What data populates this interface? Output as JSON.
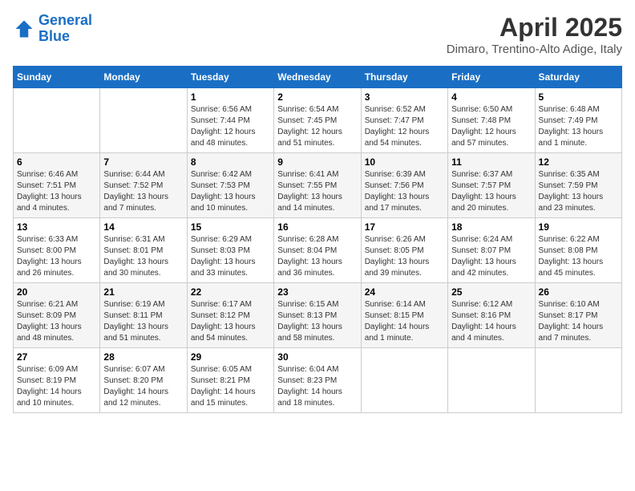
{
  "header": {
    "logo_line1": "General",
    "logo_line2": "Blue",
    "month": "April 2025",
    "location": "Dimaro, Trentino-Alto Adige, Italy"
  },
  "days_of_week": [
    "Sunday",
    "Monday",
    "Tuesday",
    "Wednesday",
    "Thursday",
    "Friday",
    "Saturday"
  ],
  "weeks": [
    [
      {
        "day": "",
        "sunrise": "",
        "sunset": "",
        "daylight": ""
      },
      {
        "day": "",
        "sunrise": "",
        "sunset": "",
        "daylight": ""
      },
      {
        "day": "1",
        "sunrise": "Sunrise: 6:56 AM",
        "sunset": "Sunset: 7:44 PM",
        "daylight": "Daylight: 12 hours and 48 minutes."
      },
      {
        "day": "2",
        "sunrise": "Sunrise: 6:54 AM",
        "sunset": "Sunset: 7:45 PM",
        "daylight": "Daylight: 12 hours and 51 minutes."
      },
      {
        "day": "3",
        "sunrise": "Sunrise: 6:52 AM",
        "sunset": "Sunset: 7:47 PM",
        "daylight": "Daylight: 12 hours and 54 minutes."
      },
      {
        "day": "4",
        "sunrise": "Sunrise: 6:50 AM",
        "sunset": "Sunset: 7:48 PM",
        "daylight": "Daylight: 12 hours and 57 minutes."
      },
      {
        "day": "5",
        "sunrise": "Sunrise: 6:48 AM",
        "sunset": "Sunset: 7:49 PM",
        "daylight": "Daylight: 13 hours and 1 minute."
      }
    ],
    [
      {
        "day": "6",
        "sunrise": "Sunrise: 6:46 AM",
        "sunset": "Sunset: 7:51 PM",
        "daylight": "Daylight: 13 hours and 4 minutes."
      },
      {
        "day": "7",
        "sunrise": "Sunrise: 6:44 AM",
        "sunset": "Sunset: 7:52 PM",
        "daylight": "Daylight: 13 hours and 7 minutes."
      },
      {
        "day": "8",
        "sunrise": "Sunrise: 6:42 AM",
        "sunset": "Sunset: 7:53 PM",
        "daylight": "Daylight: 13 hours and 10 minutes."
      },
      {
        "day": "9",
        "sunrise": "Sunrise: 6:41 AM",
        "sunset": "Sunset: 7:55 PM",
        "daylight": "Daylight: 13 hours and 14 minutes."
      },
      {
        "day": "10",
        "sunrise": "Sunrise: 6:39 AM",
        "sunset": "Sunset: 7:56 PM",
        "daylight": "Daylight: 13 hours and 17 minutes."
      },
      {
        "day": "11",
        "sunrise": "Sunrise: 6:37 AM",
        "sunset": "Sunset: 7:57 PM",
        "daylight": "Daylight: 13 hours and 20 minutes."
      },
      {
        "day": "12",
        "sunrise": "Sunrise: 6:35 AM",
        "sunset": "Sunset: 7:59 PM",
        "daylight": "Daylight: 13 hours and 23 minutes."
      }
    ],
    [
      {
        "day": "13",
        "sunrise": "Sunrise: 6:33 AM",
        "sunset": "Sunset: 8:00 PM",
        "daylight": "Daylight: 13 hours and 26 minutes."
      },
      {
        "day": "14",
        "sunrise": "Sunrise: 6:31 AM",
        "sunset": "Sunset: 8:01 PM",
        "daylight": "Daylight: 13 hours and 30 minutes."
      },
      {
        "day": "15",
        "sunrise": "Sunrise: 6:29 AM",
        "sunset": "Sunset: 8:03 PM",
        "daylight": "Daylight: 13 hours and 33 minutes."
      },
      {
        "day": "16",
        "sunrise": "Sunrise: 6:28 AM",
        "sunset": "Sunset: 8:04 PM",
        "daylight": "Daylight: 13 hours and 36 minutes."
      },
      {
        "day": "17",
        "sunrise": "Sunrise: 6:26 AM",
        "sunset": "Sunset: 8:05 PM",
        "daylight": "Daylight: 13 hours and 39 minutes."
      },
      {
        "day": "18",
        "sunrise": "Sunrise: 6:24 AM",
        "sunset": "Sunset: 8:07 PM",
        "daylight": "Daylight: 13 hours and 42 minutes."
      },
      {
        "day": "19",
        "sunrise": "Sunrise: 6:22 AM",
        "sunset": "Sunset: 8:08 PM",
        "daylight": "Daylight: 13 hours and 45 minutes."
      }
    ],
    [
      {
        "day": "20",
        "sunrise": "Sunrise: 6:21 AM",
        "sunset": "Sunset: 8:09 PM",
        "daylight": "Daylight: 13 hours and 48 minutes."
      },
      {
        "day": "21",
        "sunrise": "Sunrise: 6:19 AM",
        "sunset": "Sunset: 8:11 PM",
        "daylight": "Daylight: 13 hours and 51 minutes."
      },
      {
        "day": "22",
        "sunrise": "Sunrise: 6:17 AM",
        "sunset": "Sunset: 8:12 PM",
        "daylight": "Daylight: 13 hours and 54 minutes."
      },
      {
        "day": "23",
        "sunrise": "Sunrise: 6:15 AM",
        "sunset": "Sunset: 8:13 PM",
        "daylight": "Daylight: 13 hours and 58 minutes."
      },
      {
        "day": "24",
        "sunrise": "Sunrise: 6:14 AM",
        "sunset": "Sunset: 8:15 PM",
        "daylight": "Daylight: 14 hours and 1 minute."
      },
      {
        "day": "25",
        "sunrise": "Sunrise: 6:12 AM",
        "sunset": "Sunset: 8:16 PM",
        "daylight": "Daylight: 14 hours and 4 minutes."
      },
      {
        "day": "26",
        "sunrise": "Sunrise: 6:10 AM",
        "sunset": "Sunset: 8:17 PM",
        "daylight": "Daylight: 14 hours and 7 minutes."
      }
    ],
    [
      {
        "day": "27",
        "sunrise": "Sunrise: 6:09 AM",
        "sunset": "Sunset: 8:19 PM",
        "daylight": "Daylight: 14 hours and 10 minutes."
      },
      {
        "day": "28",
        "sunrise": "Sunrise: 6:07 AM",
        "sunset": "Sunset: 8:20 PM",
        "daylight": "Daylight: 14 hours and 12 minutes."
      },
      {
        "day": "29",
        "sunrise": "Sunrise: 6:05 AM",
        "sunset": "Sunset: 8:21 PM",
        "daylight": "Daylight: 14 hours and 15 minutes."
      },
      {
        "day": "30",
        "sunrise": "Sunrise: 6:04 AM",
        "sunset": "Sunset: 8:23 PM",
        "daylight": "Daylight: 14 hours and 18 minutes."
      },
      {
        "day": "",
        "sunrise": "",
        "sunset": "",
        "daylight": ""
      },
      {
        "day": "",
        "sunrise": "",
        "sunset": "",
        "daylight": ""
      },
      {
        "day": "",
        "sunrise": "",
        "sunset": "",
        "daylight": ""
      }
    ]
  ]
}
